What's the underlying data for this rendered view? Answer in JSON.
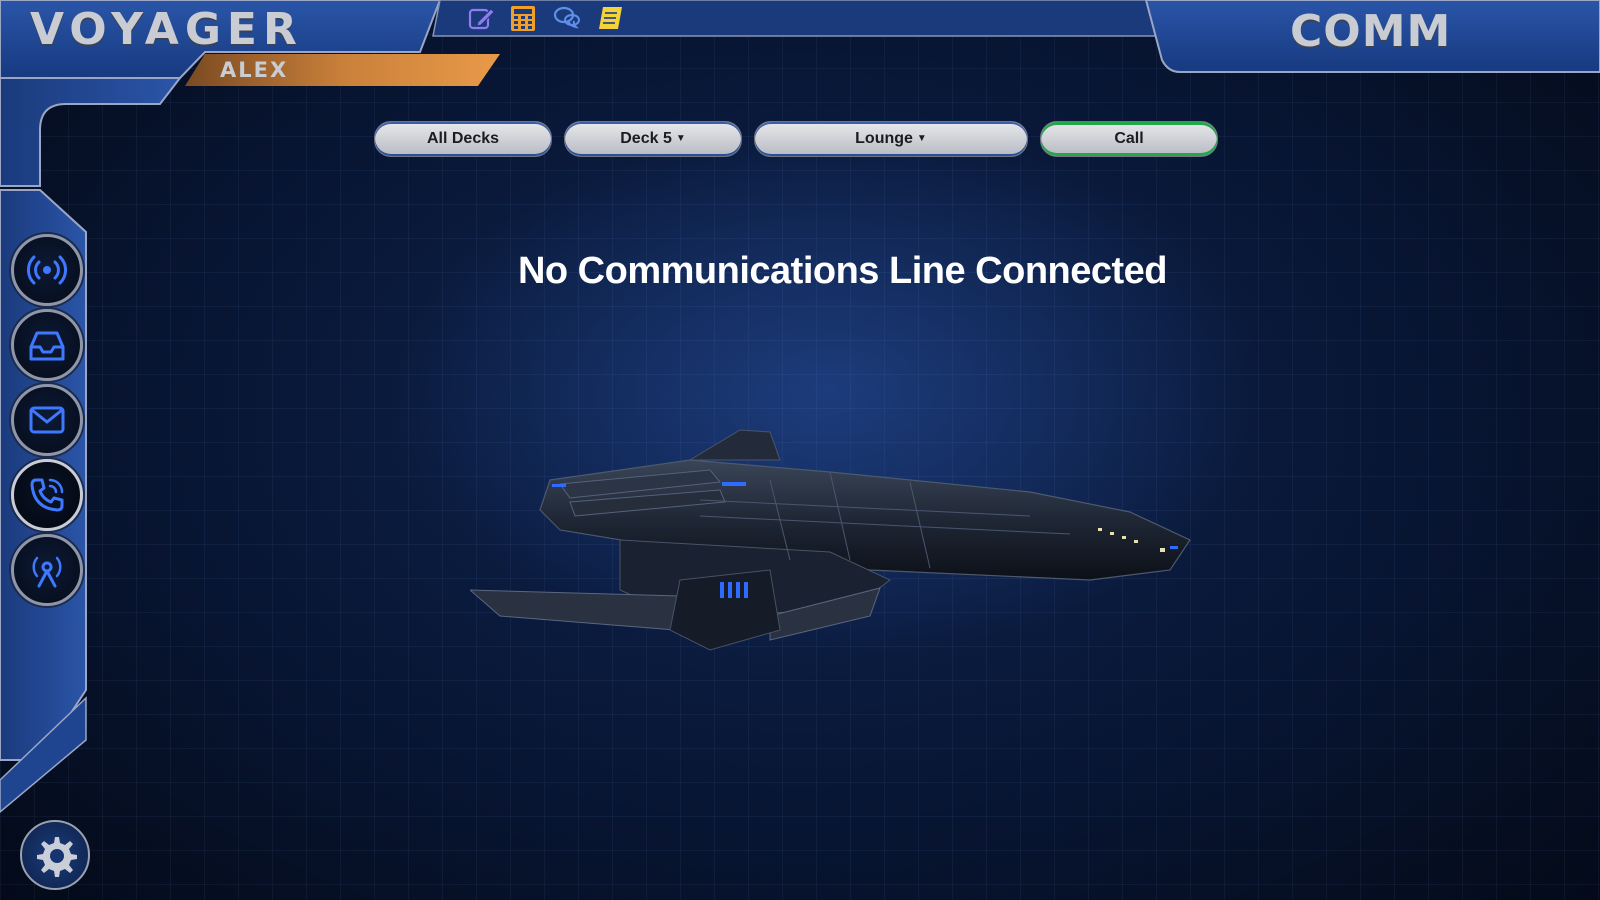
{
  "header": {
    "title": "VOYAGER",
    "user": "ALEX",
    "section": "COMM"
  },
  "toolbar": {
    "icons": [
      "edit-icon",
      "calculator-icon",
      "chat-icon",
      "notes-icon"
    ]
  },
  "filters": {
    "all_decks_label": "All Decks",
    "deck_label": "Deck 5",
    "room_label": "Lounge",
    "call_label": "Call"
  },
  "main": {
    "message": "No Communications Line Connected"
  },
  "sidebar": {
    "items": [
      {
        "icon": "broadcast-icon"
      },
      {
        "icon": "inbox-icon"
      },
      {
        "icon": "mail-icon"
      },
      {
        "icon": "phone-icon",
        "active": true
      },
      {
        "icon": "antenna-icon"
      }
    ],
    "settings_icon": "gear-icon"
  },
  "colors": {
    "frame_blue": "#1e3f86",
    "accent_orange": "#d98a3a",
    "call_green": "#22a84a",
    "toolbar_purple": "#8f7cf0",
    "toolbar_orange": "#f0a02a",
    "toolbar_blue": "#5f8fe8",
    "toolbar_yellow": "#f3d23a"
  }
}
